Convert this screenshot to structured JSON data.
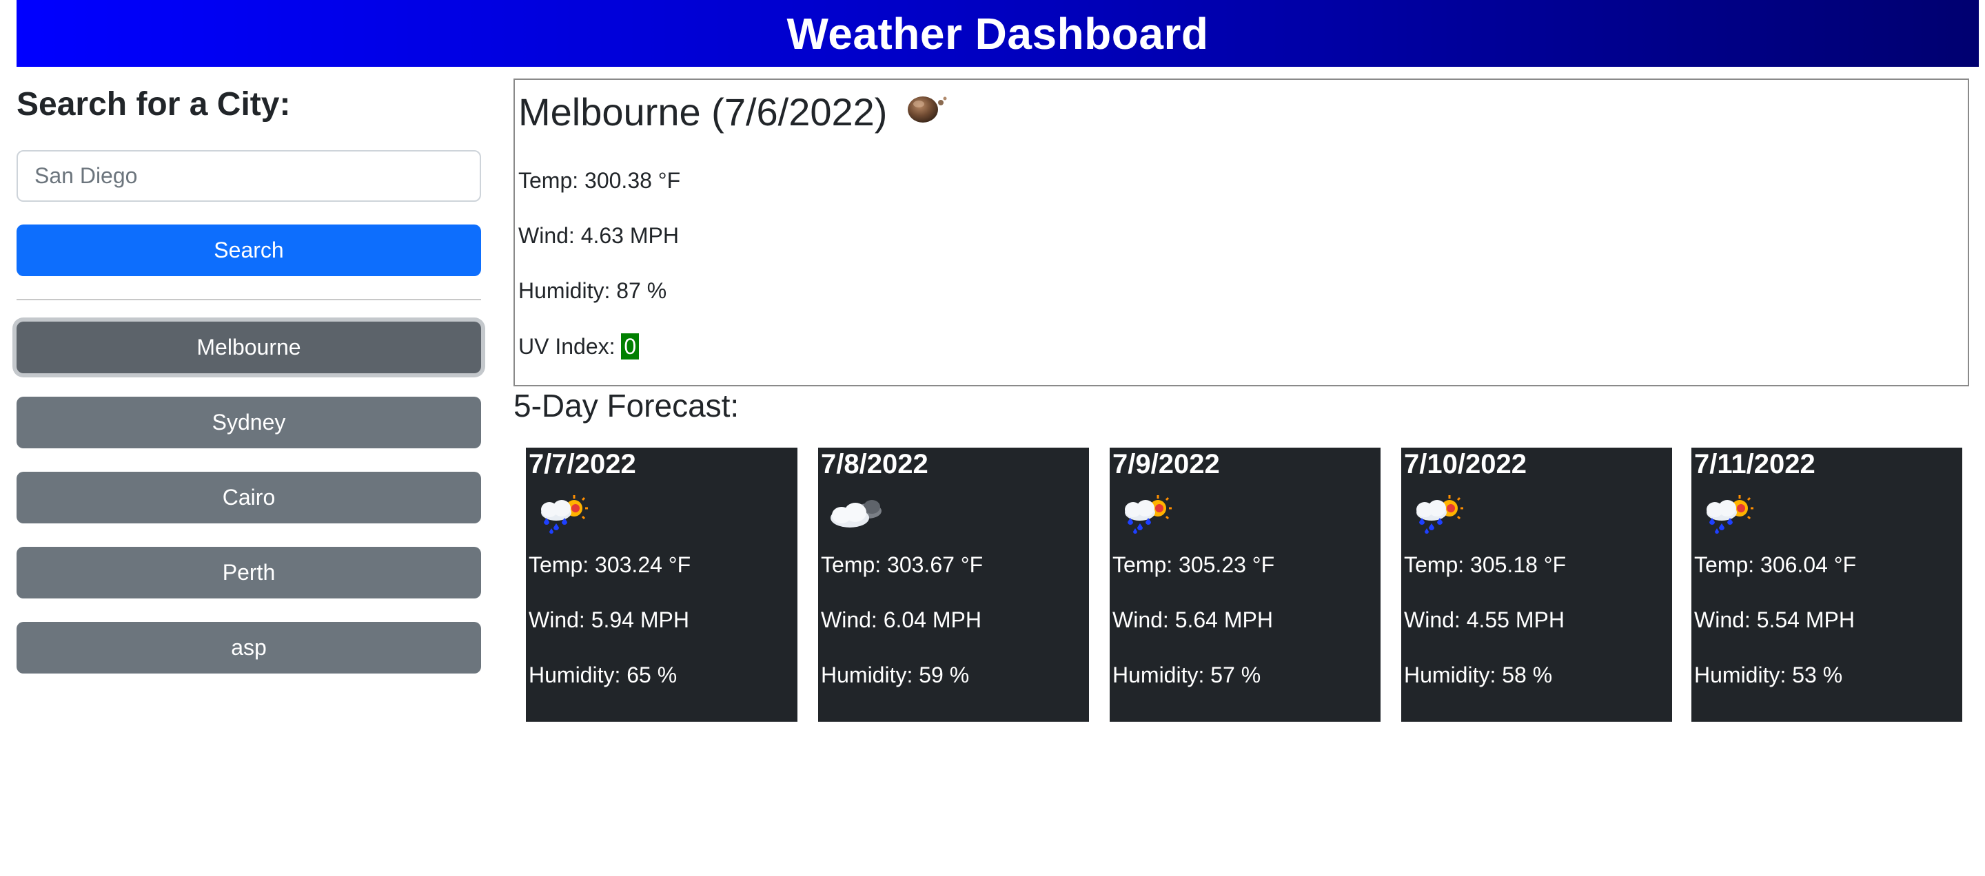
{
  "header": {
    "title": "Weather Dashboard"
  },
  "sidebar": {
    "heading": "Search for a City:",
    "search_value": "San Diego",
    "search_placeholder": "San Diego",
    "search_button_label": "Search",
    "history": [
      {
        "label": "Melbourne",
        "active": true
      },
      {
        "label": "Sydney",
        "active": false
      },
      {
        "label": "Cairo",
        "active": false
      },
      {
        "label": "Perth",
        "active": false
      },
      {
        "label": "asp",
        "active": false
      }
    ]
  },
  "current": {
    "title": "Melbourne (7/6/2022)",
    "icon": "haze-icon",
    "temp": "Temp: 300.38 °F",
    "wind": "Wind: 4.63 MPH",
    "humidity": "Humidity: 87 %",
    "uv_label": "UV Index: ",
    "uv_value": "0",
    "uv_color": "#008000"
  },
  "forecast": {
    "heading": "5-Day Forecast:",
    "days": [
      {
        "date": "7/7/2022",
        "icon": "rain-sun-cloud-icon",
        "temp": "Temp: 303.24 °F",
        "wind": "Wind: 5.94 MPH",
        "humidity": "Humidity: 65 %"
      },
      {
        "date": "7/8/2022",
        "icon": "cloudy-icon",
        "temp": "Temp: 303.67 °F",
        "wind": "Wind: 6.04 MPH",
        "humidity": "Humidity: 59 %"
      },
      {
        "date": "7/9/2022",
        "icon": "rain-sun-cloud-icon",
        "temp": "Temp: 305.23 °F",
        "wind": "Wind: 5.64 MPH",
        "humidity": "Humidity: 57 %"
      },
      {
        "date": "7/10/2022",
        "icon": "rain-sun-cloud-icon",
        "temp": "Temp: 305.18 °F",
        "wind": "Wind: 4.55 MPH",
        "humidity": "Humidity: 58 %"
      },
      {
        "date": "7/11/2022",
        "icon": "rain-sun-cloud-icon",
        "temp": "Temp: 306.04 °F",
        "wind": "Wind: 5.54 MPH",
        "humidity": "Humidity: 53 %"
      }
    ]
  },
  "colors": {
    "header_start": "#0000ff",
    "header_end": "#000070",
    "primary": "#0d6efd",
    "secondary": "#6c757d",
    "card_bg": "#212529"
  }
}
